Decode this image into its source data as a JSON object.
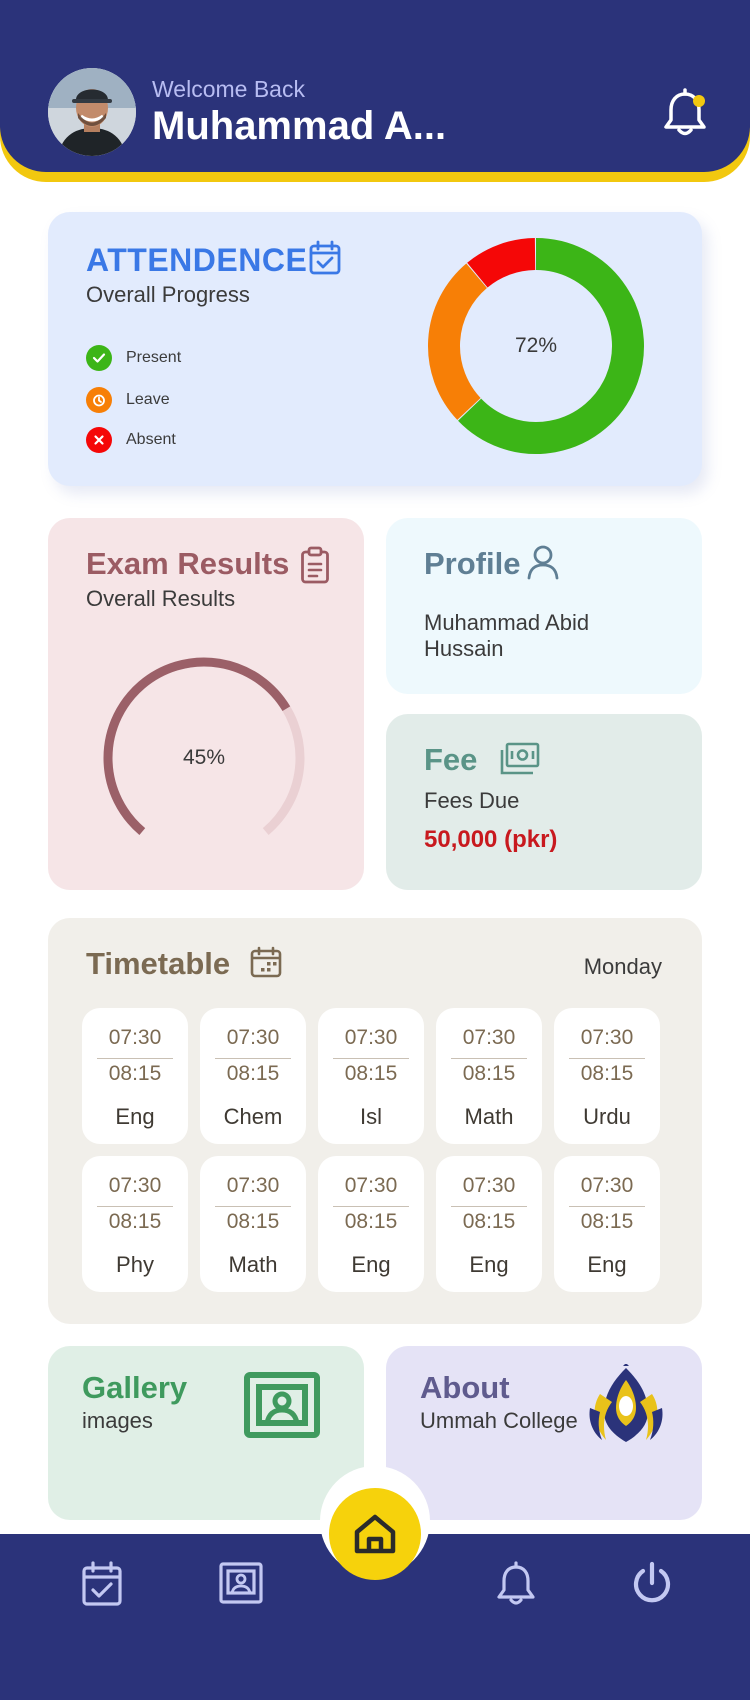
{
  "header": {
    "welcome": "Welcome Back",
    "username": "Muhammad A...",
    "notification_dot_color": "#f2c80f"
  },
  "attendance": {
    "title": "ATTENDENCE",
    "subtitle": "Overall Progress",
    "center_label": "72%",
    "legend": [
      {
        "label": "Present",
        "color": "#3cb517",
        "icon": "check-icon"
      },
      {
        "label": "Leave",
        "color": "#f77f06",
        "icon": "clock-icon"
      },
      {
        "label": "Absent",
        "color": "#f50707",
        "icon": "cross-icon"
      }
    ]
  },
  "exam": {
    "title": "Exam Results",
    "subtitle": "Overall Results",
    "center_label": "45%"
  },
  "profile": {
    "title": "Profile",
    "name_line1": "Muhammad Abid",
    "name_line2": "Hussain"
  },
  "fee": {
    "title": "Fee",
    "subtitle": "Fees Due",
    "amount": "50,000 (pkr)"
  },
  "timetable": {
    "title": "Timetable",
    "day": "Monday",
    "slots": [
      {
        "start": "07:30",
        "end": "08:15",
        "subject": "Eng"
      },
      {
        "start": "07:30",
        "end": "08:15",
        "subject": "Chem"
      },
      {
        "start": "07:30",
        "end": "08:15",
        "subject": "Isl"
      },
      {
        "start": "07:30",
        "end": "08:15",
        "subject": "Math"
      },
      {
        "start": "07:30",
        "end": "08:15",
        "subject": "Urdu"
      },
      {
        "start": "07:30",
        "end": "08:15",
        "subject": "Phy"
      },
      {
        "start": "07:30",
        "end": "08:15",
        "subject": "Math"
      },
      {
        "start": "07:30",
        "end": "08:15",
        "subject": "Eng"
      },
      {
        "start": "07:30",
        "end": "08:15",
        "subject": "Eng"
      },
      {
        "start": "07:30",
        "end": "08:15",
        "subject": "Eng"
      }
    ]
  },
  "gallery": {
    "title": "Gallery",
    "subtitle": "images"
  },
  "about": {
    "title": "About",
    "subtitle": "Ummah College"
  },
  "chart_data": [
    {
      "type": "pie",
      "categories": [
        "Present",
        "Leave",
        "Absent"
      ],
      "values": [
        63,
        26,
        11
      ],
      "colors": [
        "#3cb517",
        "#f77f06",
        "#f50707"
      ],
      "style": "donut",
      "center_label": "72%"
    },
    {
      "type": "gauge",
      "value": 45,
      "max": 100,
      "colors": [
        "#9b6068",
        "#ead0d3"
      ],
      "center_label": "45%"
    }
  ],
  "colors": {
    "primary": "#2b337a",
    "accent": "#f6d20c",
    "attendance_title": "#3a78e6",
    "exam_title": "#9b5b63",
    "profile_title": "#5f7f94",
    "fee_title": "#5a9487",
    "timetable_title": "#7b6a52",
    "gallery_title": "#3f9a5e",
    "about_title": "#5f5b8e"
  }
}
